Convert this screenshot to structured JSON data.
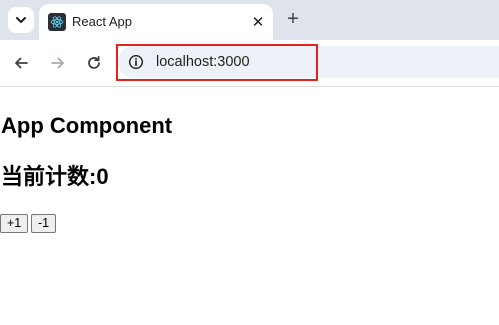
{
  "browser": {
    "tab": {
      "title": "React App",
      "favicon": "react-icon",
      "close_glyph": "✕"
    },
    "new_tab_glyph": "+",
    "address_bar": {
      "url": "localhost:3000",
      "site_info_icon": "info-icon"
    },
    "highlight_color": "#e0241c"
  },
  "page": {
    "heading": "App Component",
    "count_text": "当前计数:0",
    "buttons": {
      "increment": "+1",
      "decrement": "-1"
    }
  }
}
